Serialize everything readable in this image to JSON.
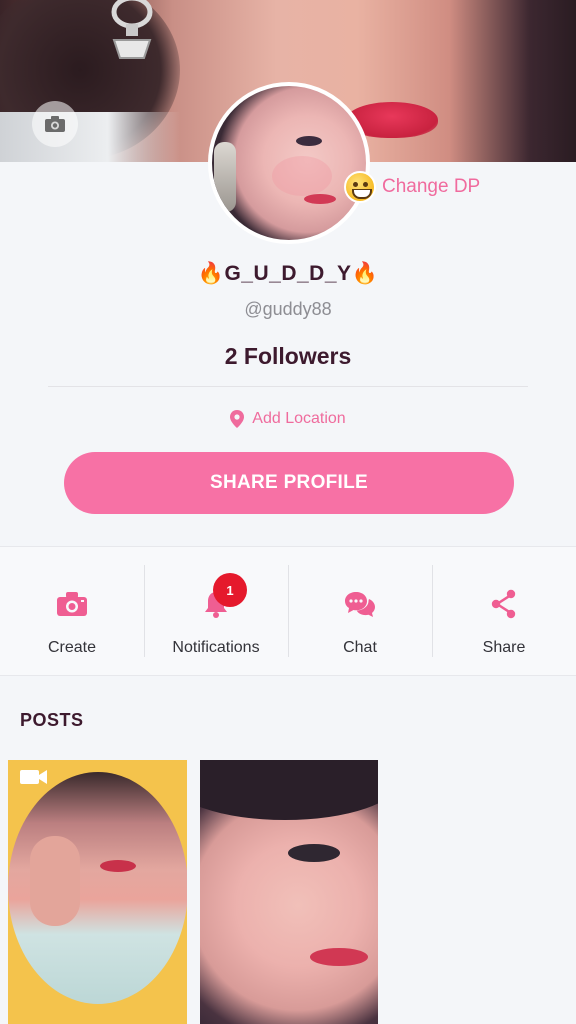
{
  "profile": {
    "change_dp_label": "Change DP",
    "name": "🔥G_U_D_D_Y🔥",
    "handle": "@guddy88",
    "followers": "2 Followers",
    "add_location": "Add Location",
    "share_button": "SHARE PROFILE"
  },
  "actions": [
    {
      "label": "Create",
      "icon": "camera-icon"
    },
    {
      "label": "Notifications",
      "icon": "bell-icon",
      "badge": "1"
    },
    {
      "label": "Chat",
      "icon": "chat-icon"
    },
    {
      "label": "Share",
      "icon": "share-icon"
    }
  ],
  "posts": {
    "title": "POSTS"
  },
  "colors": {
    "accent": "#f771a5",
    "accent_text": "#ef6b9d",
    "dark_text": "#3d1a2e",
    "badge": "#e5192c",
    "post_bg": "#f4c34c"
  }
}
